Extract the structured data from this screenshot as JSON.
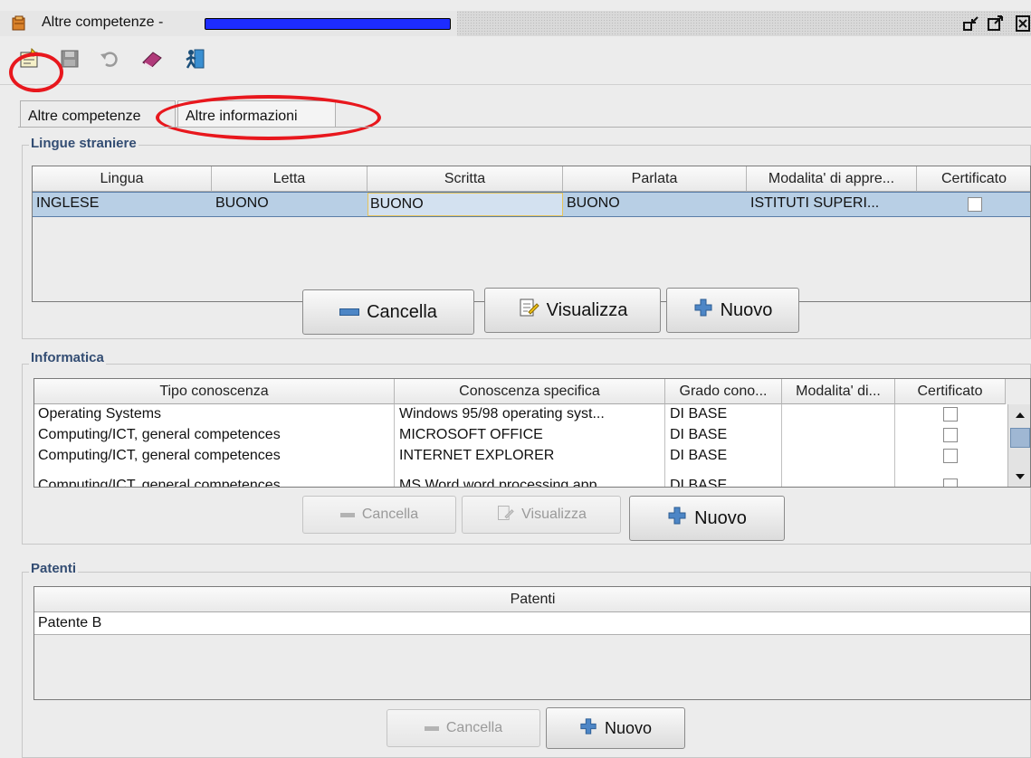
{
  "window": {
    "title": "Altre competenze - ",
    "redacted_color": "#1d2cff"
  },
  "toolbar": {
    "icons": [
      "new-document-icon",
      "save-icon",
      "undo-icon",
      "book-icon",
      "exit-icon"
    ],
    "highlight_color": "#e8171d"
  },
  "tabs": [
    {
      "label": "Altre competenze",
      "active": true
    },
    {
      "label": "Altre informazioni",
      "active": false
    }
  ],
  "lingue": {
    "title": "Lingue straniere",
    "headers": [
      "Lingua",
      "Letta",
      "Scritta",
      "Parlata",
      "Modalita' di appre...",
      "Certificato"
    ],
    "rows": [
      [
        "INGLESE",
        "BUONO",
        "BUONO",
        "BUONO",
        "ISTITUTI SUPERI..."
      ]
    ],
    "buttons": {
      "cancella": "Cancella",
      "visualizza": "Visualizza",
      "nuovo": "Nuovo"
    }
  },
  "informatica": {
    "title": "Informatica",
    "headers": [
      "Tipo conoscenza",
      "Conoscenza specifica",
      "Grado cono...",
      "Modalita' di...",
      "Certificato"
    ],
    "rows": [
      [
        "Operating Systems",
        "Windows 95/98 operating syst...",
        "DI BASE",
        ""
      ],
      [
        "Computing/ICT, general competences",
        "MICROSOFT OFFICE",
        "DI BASE",
        ""
      ],
      [
        "Computing/ICT, general competences",
        "INTERNET EXPLORER",
        "DI BASE",
        ""
      ],
      [
        "Computing/ICT, general competences",
        "MS Word word processing app...",
        "DI BASE",
        ""
      ]
    ],
    "buttons": {
      "cancella": "Cancella",
      "visualizza": "Visualizza",
      "nuovo": "Nuovo"
    }
  },
  "patenti": {
    "title": "Patenti",
    "header": "Patenti",
    "rows": [
      "Patente B"
    ],
    "buttons": {
      "cancella": "Cancella",
      "nuovo": "Nuovo"
    }
  },
  "colors": {
    "selected_row": "#b8cfe5",
    "group_title": "#334d73"
  }
}
